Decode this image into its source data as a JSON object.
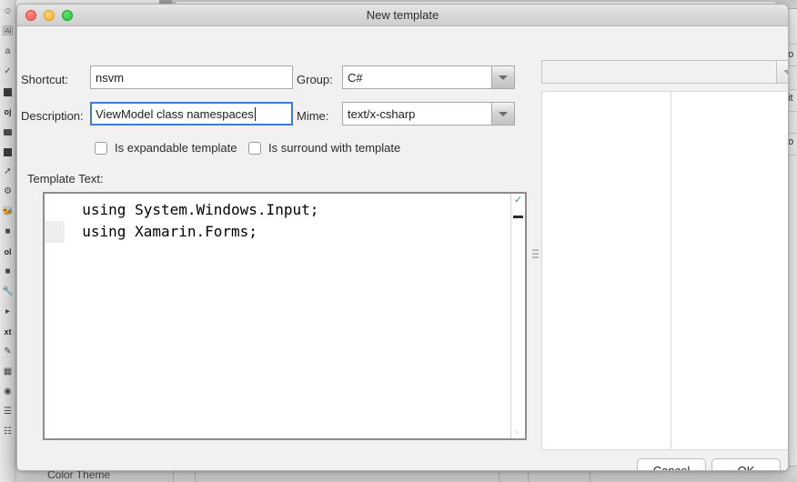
{
  "window": {
    "title": "New template",
    "traffic_lights": [
      "close",
      "minimize",
      "zoom"
    ]
  },
  "form": {
    "shortcut_label": "Shortcut:",
    "shortcut_value": "nsvm",
    "group_label": "Group:",
    "group_value": "C#",
    "description_label": "Description:",
    "description_value": "ViewModel class namespaces",
    "mime_label": "Mime:",
    "mime_value": "text/x-csharp",
    "checkbox_expandable": "Is expandable template",
    "checkbox_surround": "Is surround with template",
    "template_text_label": "Template Text:",
    "template_code": "  using System.Windows.Input;\n  using Xamarin.Forms;",
    "preview_combo_value": ""
  },
  "editor": {
    "stripe_ok_glyph": "✓",
    "stripe_bottom_glyph": "▫"
  },
  "buttons": {
    "cancel": "Cancel",
    "ok": "OK"
  },
  "background": {
    "bottom_status": "Color Theme",
    "right_fragments": [
      "do",
      "dit",
      "no"
    ],
    "toolbar_icons": [
      "smiley-icon",
      "image-icon",
      "text-a-icon",
      "check-icon",
      "square-dark-icon",
      "project-icon",
      "monitor-icon",
      "square-dark2-icon",
      "branch-icon",
      "gear-icon",
      "bug-icon",
      "apple-icon",
      "tool-label-icon",
      "apple2-icon",
      "wrench-icon",
      "flag-icon",
      "text-label-icon",
      "edit-box-icon",
      "grid-icon",
      "globe-icon",
      "list-icon",
      "list2-icon"
    ]
  },
  "colors": {
    "accent_focus": "#3d79d6",
    "ok_green": "#2fa14b",
    "light_red": "#fa5b50",
    "light_yellow": "#ffb627",
    "light_green": "#24c23c"
  }
}
